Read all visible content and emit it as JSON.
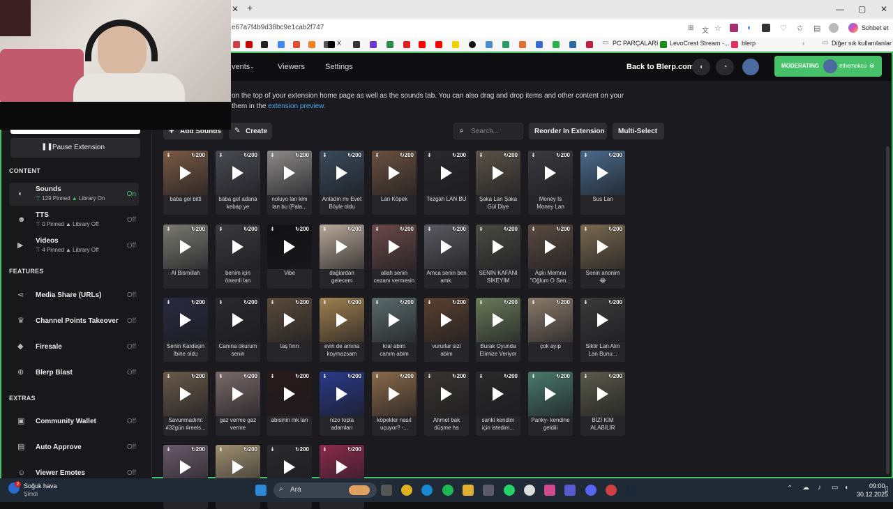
{
  "browser": {
    "url": "e67a7f4b9d38bc9e1cab2f747",
    "copilot_label": "Sohbet et",
    "bookmarks": [
      {
        "label": "X",
        "icon": "x-icon"
      },
      {
        "label": "PC PARÇALARI",
        "icon": "folder-icon"
      },
      {
        "label": "LevoCrest Stream -...",
        "icon": "levocrest-icon"
      },
      {
        "label": "blerp",
        "icon": "blerp-icon"
      }
    ],
    "other_bookmarks": "Diğer sık kullanılanlar",
    "colors": {
      "accent": "#47c26a"
    }
  },
  "header": {
    "nav": [
      "vents",
      "Viewers",
      "Settings"
    ],
    "back_link": "Back to Blerp.com",
    "moderating_label": "MODERATING",
    "moderating_user": "ethemokcu"
  },
  "intro": {
    "line1": "on the top of your extension home page as well as the sounds tab. You can also drag and drop items and other content on your",
    "line2_prefix": "them in the",
    "line2_link": "extension preview."
  },
  "toolbar": {
    "add_sounds": "Add Sounds",
    "create": "Create",
    "search_placeholder": "Search...",
    "reorder": "Reorder In Extension",
    "multi_select": "Multi-Select"
  },
  "sidebar": {
    "pause_label": "Pause Extension",
    "content_heading": "CONTENT",
    "features_heading": "FEATURES",
    "extras_heading": "EXTRAS",
    "content_items": [
      {
        "label": "Sounds",
        "pinned": "129 Pinned",
        "library": "Library On",
        "status": "On",
        "icon": "speaker-icon"
      },
      {
        "label": "TTS",
        "pinned": "0 Pinned",
        "library": "Library Off",
        "status": "Off",
        "icon": "tts-icon"
      },
      {
        "label": "Videos",
        "pinned": "4 Pinned",
        "library": "Library Off",
        "status": "Off",
        "icon": "video-icon"
      }
    ],
    "feature_items": [
      {
        "label": "Media Share (URLs)",
        "status": "Off",
        "icon": "share-icon"
      },
      {
        "label": "Channel Points Takeover",
        "status": "Off",
        "icon": "trophy-icon"
      },
      {
        "label": "Firesale",
        "status": "Off",
        "icon": "tag-icon"
      },
      {
        "label": "Blerp Blast",
        "status": "Off",
        "icon": "blast-icon"
      }
    ],
    "extra_items": [
      {
        "label": "Community Wallet",
        "status": "Off",
        "icon": "wallet-icon"
      },
      {
        "label": "Auto Approve",
        "status": "Off",
        "icon": "approve-icon"
      },
      {
        "label": "Viewer Emotes",
        "status": "Off",
        "icon": "emote-icon"
      }
    ]
  },
  "sounds": {
    "count_label": "200",
    "tiles": [
      {
        "label": "baba gel bitti",
        "color": "#7a5a44"
      },
      {
        "label": "baba gel adana\nkebap ye",
        "color": "#4a4a52"
      },
      {
        "label": "noluyo lan kim\nlan bu (Pala...",
        "color": "#8c8a88"
      },
      {
        "label": "Anladın mı Evet\nBöyle oldu",
        "color": "#3a4a5a"
      },
      {
        "label": "Lan Köpek",
        "color": "#6a5040"
      },
      {
        "label": "Tezgah LAN BU",
        "color": "#2a2a2e"
      },
      {
        "label": "Şaka Lan Şaka\nGül Diye",
        "color": "#5a5248"
      },
      {
        "label": "Money Is\nMoney Lan",
        "color": "#3a3a40"
      },
      {
        "label": "Sus Lan",
        "color": "#4a6a8a"
      },
      {
        "label": "Al Bismillah",
        "color": "#7a7a72"
      },
      {
        "label": "benim için\nönemli lan",
        "color": "#3a3a3e"
      },
      {
        "label": "Vibe",
        "color": "#111114"
      },
      {
        "label": "dağlardan\ngelecem",
        "color": "#b8a898"
      },
      {
        "label": "allah senin\ncezanı vermesin",
        "color": "#6a4a48"
      },
      {
        "label": "Amca senin ben\namk.",
        "color": "#5a5a60"
      },
      {
        "label": "SENİN KAFANI\nSİKEYİM",
        "color": "#4a4a44"
      },
      {
        "label": "Aşkı Memnu\n\"Oğlum O Sen...",
        "color": "#5a4a40"
      },
      {
        "label": "Senin anonim\n😂",
        "color": "#7a6a50"
      },
      {
        "label": "Senin Kardeşin\nİbine oldu",
        "color": "#2a2a40"
      },
      {
        "label": "Canına okurum\nsenin",
        "color": "#2a2a2e"
      },
      {
        "label": "taş fırın",
        "color": "#5a4a3a"
      },
      {
        "label": "evin de amına\nkoymazsam",
        "color": "#a08050"
      },
      {
        "label": "kral abim\ncanım abim",
        "color": "#5a6a6a"
      },
      {
        "label": "vururlar sizi\nabim",
        "color": "#5a4030"
      },
      {
        "label": "Burak Oyunda\nElimize Veriyor",
        "color": "#6a7a5a"
      },
      {
        "label": "çok ayıp",
        "color": "#8a7a6a"
      },
      {
        "label": "Siktir Lan Alın\nLan Bunu...",
        "color": "#3a3a3a"
      },
      {
        "label": "Savunmadım!\n#32gün #reels...",
        "color": "#6a5a4a"
      },
      {
        "label": "gaz verme gaz\nverme",
        "color": "#7a6a6a"
      },
      {
        "label": "abisinin mk lan",
        "color": "#2a1a1a"
      },
      {
        "label": "nizo topla\nadamları",
        "color": "#2a3a8a"
      },
      {
        "label": "köpekler nasıl\nuçuyor? -...",
        "color": "#8a6a4a"
      },
      {
        "label": "Ahmet bak\ndüşme ha",
        "color": "#3a3430"
      },
      {
        "label": "sanki kendim\niçin istedim...",
        "color": "#2a2a2a"
      },
      {
        "label": "Panky- kendine\ngeldiii",
        "color": "#4a7a6a"
      },
      {
        "label": "BİZİ KİM\nALABİLİR",
        "color": "#5a5a4a"
      },
      {
        "label": "",
        "color": "#6a5a6a"
      },
      {
        "label": "",
        "color": "#a09070"
      },
      {
        "label": "",
        "color": "#2a2a2e"
      },
      {
        "label": "",
        "color": "#8a2a4a"
      }
    ]
  },
  "taskbar": {
    "weather_title": "Soğuk hava",
    "weather_sub": "Şimdi",
    "search": "Ara",
    "time": "09:00",
    "date": "30.12.2025",
    "badge": "2"
  }
}
